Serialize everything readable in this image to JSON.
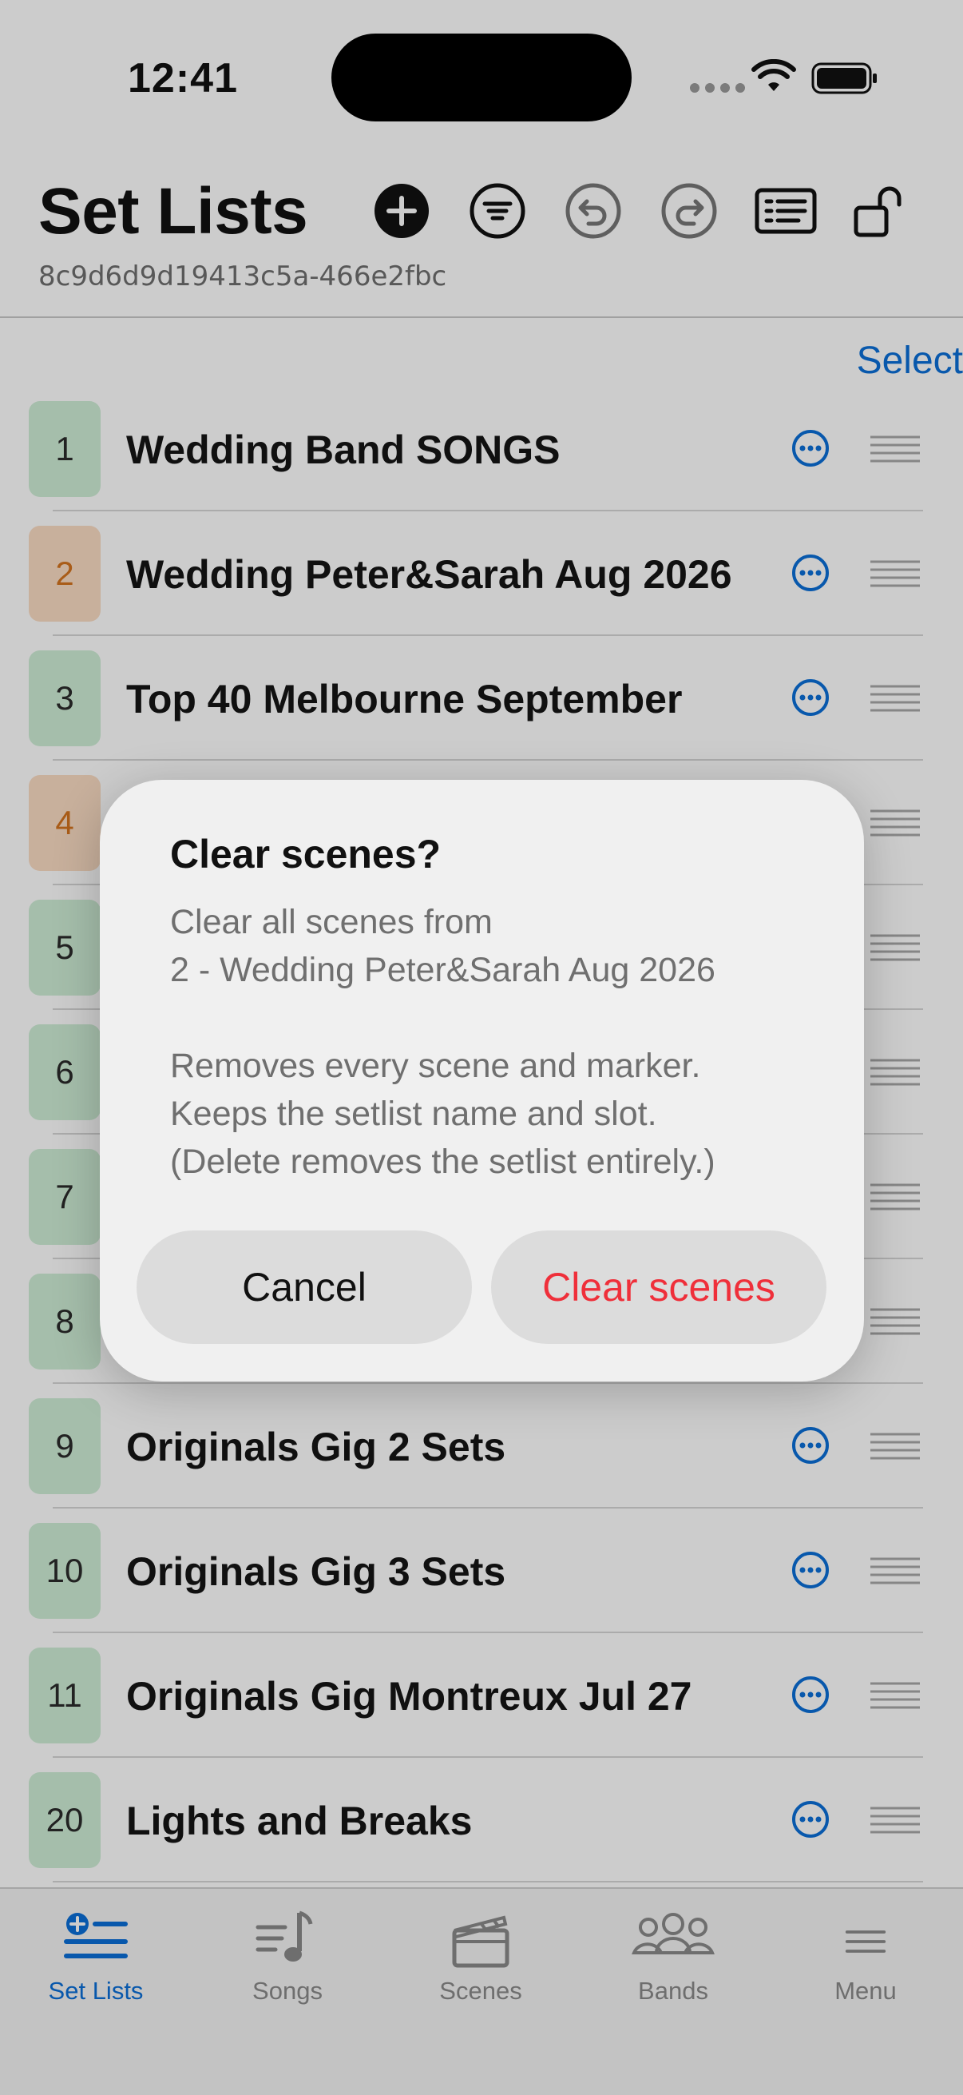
{
  "status_bar": {
    "time": "12:41"
  },
  "header": {
    "title": "Set Lists",
    "session_id": "8c9d6d9d19413c5a-466e2fbc",
    "buttons": [
      "add-icon",
      "filter-icon",
      "undo-icon",
      "redo-icon",
      "list-view-icon",
      "unlock-icon"
    ]
  },
  "select_label": "Select",
  "setlists": [
    {
      "number": "1",
      "name": "Wedding Band SONGS",
      "color": "green"
    },
    {
      "number": "2",
      "name": "Wedding Peter&Sarah Aug 2026",
      "color": "orange"
    },
    {
      "number": "3",
      "name": "Top 40 Melbourne September",
      "color": "green"
    },
    {
      "number": "4",
      "name": "",
      "color": "orange"
    },
    {
      "number": "5",
      "name": "",
      "color": "green"
    },
    {
      "number": "6",
      "name": "",
      "color": "green"
    },
    {
      "number": "7",
      "name": "",
      "color": "green"
    },
    {
      "number": "8",
      "name": "",
      "color": "green"
    },
    {
      "number": "9",
      "name": "Originals Gig 2 Sets",
      "color": "green"
    },
    {
      "number": "10",
      "name": "Originals Gig 3 Sets",
      "color": "green"
    },
    {
      "number": "11",
      "name": "Originals Gig Montreux Jul 27",
      "color": "green"
    },
    {
      "number": "20",
      "name": "Lights and Breaks",
      "color": "green"
    }
  ],
  "tabs": [
    {
      "label": "Set Lists",
      "icon": "setlist-icon",
      "active": true
    },
    {
      "label": "Songs",
      "icon": "music-note-icon",
      "active": false
    },
    {
      "label": "Scenes",
      "icon": "clapperboard-icon",
      "active": false
    },
    {
      "label": "Bands",
      "icon": "people-icon",
      "active": false
    },
    {
      "label": "Menu",
      "icon": "hamburger-icon",
      "active": false
    }
  ],
  "dialog": {
    "title": "Clear scenes?",
    "body_line1": "Clear all scenes from",
    "body_line2": "2 - Wedding Peter&Sarah Aug 2026",
    "body_line3": "Removes every scene and marker.",
    "body_line4": "Keeps the setlist name and slot.",
    "body_line5": "(Delete removes the setlist entirely.)",
    "cancel_label": "Cancel",
    "confirm_label": "Clear scenes"
  },
  "colors": {
    "accent": "#0a6fd8",
    "destructive": "#ef2f3a",
    "badge_green": "#cfeed6",
    "badge_orange": "#fbdcc3"
  }
}
